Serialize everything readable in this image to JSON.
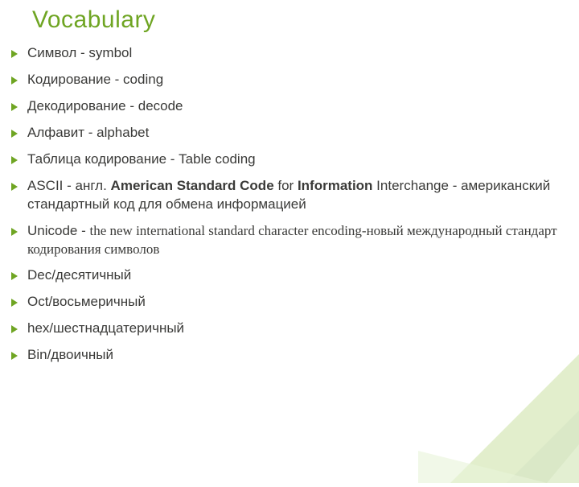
{
  "title": "Vocabulary",
  "items": [
    {
      "segments": [
        {
          "t": "Символ  - symbol"
        }
      ]
    },
    {
      "segments": [
        {
          "t": "Кодирование  - coding"
        }
      ]
    },
    {
      "segments": [
        {
          "t": "Декодирование  -  decode"
        }
      ]
    },
    {
      "segments": [
        {
          "t": "Алфавит  - alphabet"
        }
      ]
    },
    {
      "segments": [
        {
          "t": "Таблица кодирование   - Table coding"
        }
      ]
    },
    {
      "segments": [
        {
          "t": "ASCII - англ. "
        },
        {
          "t": "American Standard Code",
          "b": true
        },
        {
          "t": " for "
        },
        {
          "t": "Information",
          "b": true
        },
        {
          "t": " Interchange - американский стандартный код для обмена информацией"
        }
      ]
    },
    {
      "segments": [
        {
          "t": "Unicode - "
        },
        {
          "t": "the new international standard character encoding-новый международный стандарт кодирования символов",
          "serif": true
        }
      ]
    },
    {
      "segments": [
        {
          "t": "Dec/десятичный"
        }
      ]
    },
    {
      "segments": [
        {
          "t": "Oct/восьмеричный"
        }
      ]
    },
    {
      "segments": [
        {
          "t": "hex/шестнадцатеричный"
        }
      ]
    },
    {
      "segments": [
        {
          "t": "Bin/двоичный"
        }
      ]
    }
  ]
}
